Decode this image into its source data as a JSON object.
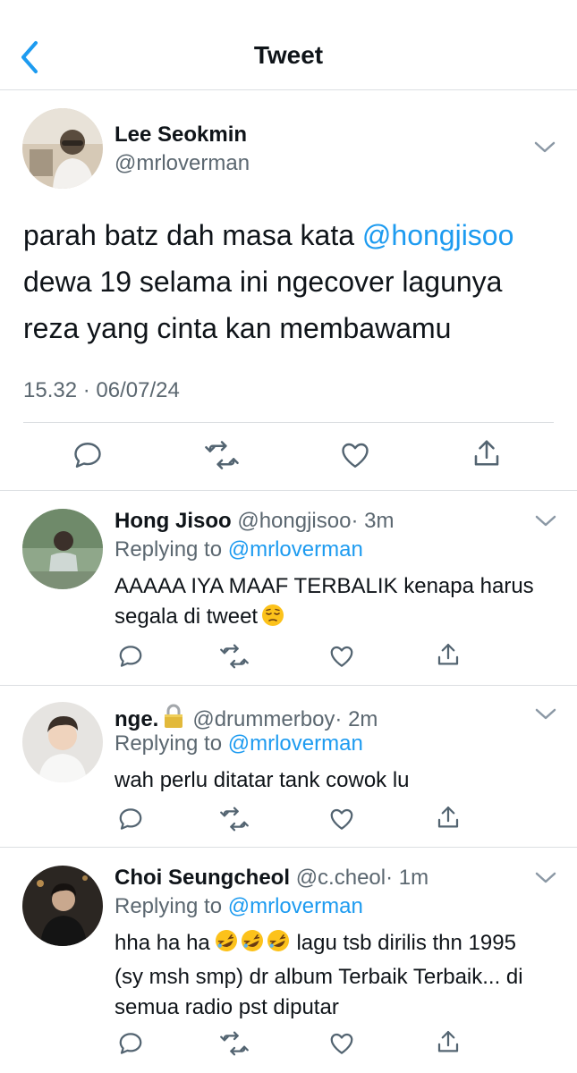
{
  "nav": {
    "title": "Tweet"
  },
  "tweet": {
    "author": {
      "name": "Lee Seokmin",
      "handle": "@mrloverman"
    },
    "text_before": "parah batz dah masa kata ",
    "mention": "@hongjisoo",
    "text_after": " dewa 19 selama ini ngecover lagunya reza yang cinta kan membawamu",
    "timestamp": "15.32 · 06/07/24"
  },
  "replies": [
    {
      "name": "Hong Jisoo",
      "handle": "@hongjisoo",
      "time": "· 3m",
      "replying_prefix": "Replying to ",
      "replying_to": "@mrloverman",
      "text": "AAAAA IYA MAAF TERBALIK kenapa harus segala di tweet",
      "emoji": "pensive-face"
    },
    {
      "name": "nge.",
      "handle": "@drummerboy",
      "time": "· 2m",
      "locked": true,
      "replying_prefix": "Replying to ",
      "replying_to": "@mrloverman",
      "text": "wah perlu ditatar tank cowok lu"
    },
    {
      "name": "Choi Seungcheol",
      "handle": "@c.cheol",
      "time": "· 1m",
      "replying_prefix": "Replying to ",
      "replying_to": "@mrloverman",
      "text_line1": "hha ha ha",
      "emoji": "rolling-on-floor-laughing x3",
      "text_rest": "lagu tsb dirilis thn 1995 (sy msh smp) dr album Terbaik Terbaik... di semua radio pst diputar"
    }
  ],
  "colors": {
    "accent": "#1d9bf0",
    "secondary_text": "#5b6770",
    "divider": "#dcdfe2",
    "icon": "#536471"
  }
}
